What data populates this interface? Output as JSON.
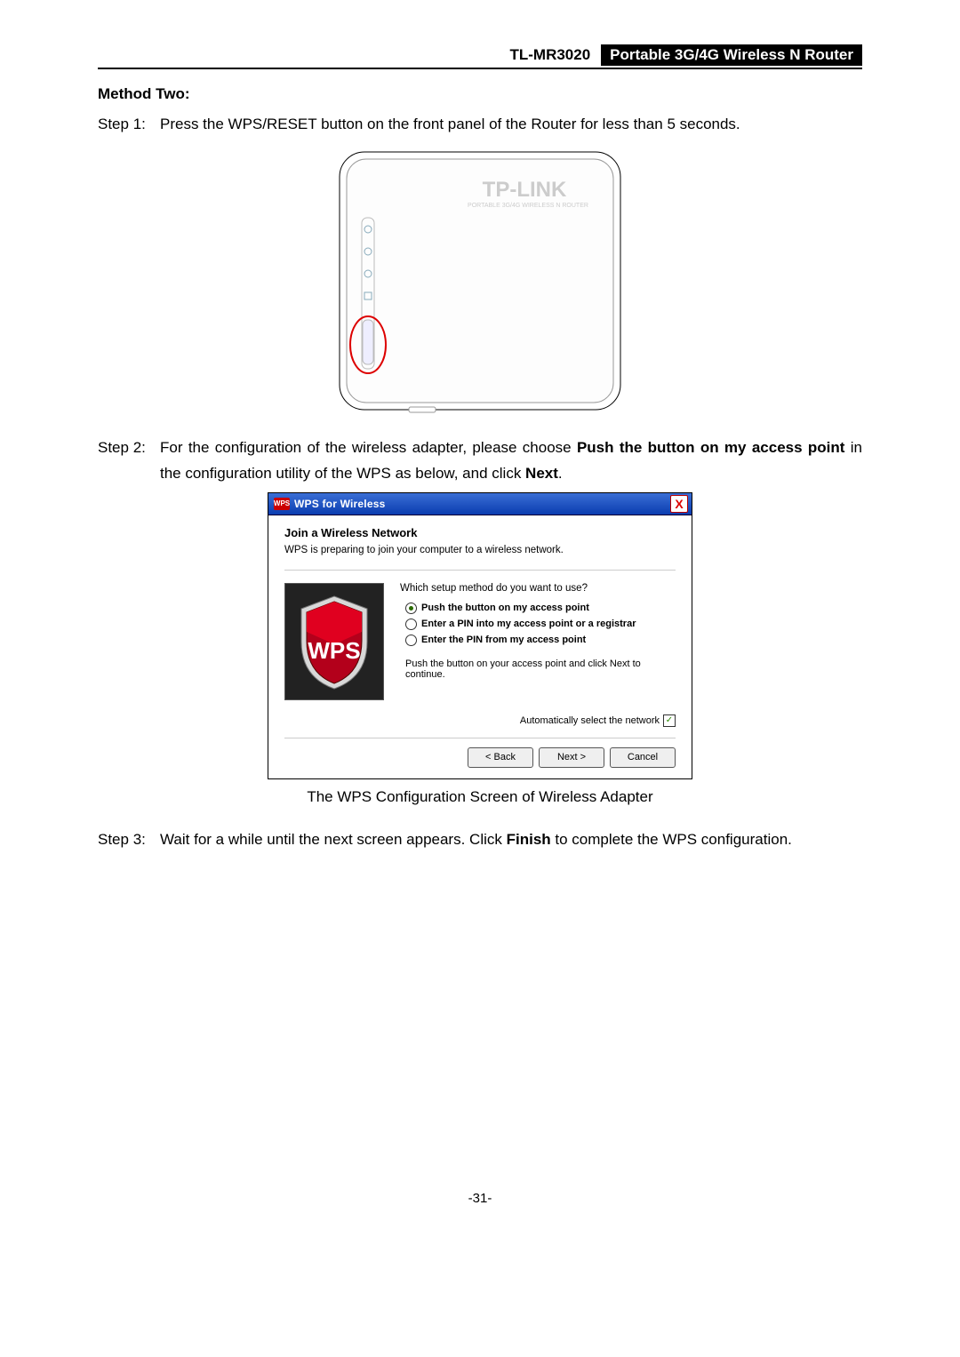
{
  "header": {
    "model": "TL-MR3020",
    "subtitle": "Portable 3G/4G Wireless N Router"
  },
  "method_title": "Method Two:",
  "step1": {
    "label": "Step 1:",
    "text": "Press the WPS/RESET button on the front panel of the Router for less than 5 seconds."
  },
  "router_brand": "TP-LINK",
  "step2": {
    "label": "Step 2:",
    "pre": "For the configuration of the wireless adapter, please choose ",
    "bold1": "Push the button on my access point",
    "mid": " in the configuration utility of the WPS as below, and click ",
    "bold2": "Next",
    "post": "."
  },
  "dialog": {
    "badge": "WPS",
    "title": "WPS for Wireless",
    "close": "X",
    "heading": "Join a Wireless Network",
    "sub": "WPS is preparing to join your computer to a wireless network.",
    "prompt": "Which setup method do you want to use?",
    "opt1": "Push the button on my access point",
    "opt2": "Enter a PIN into my access point or a registrar",
    "opt3": "Enter the PIN from my access point",
    "hint": "Push the button on your access point and click Next to continue.",
    "autosel": "Automatically select the network",
    "shield_text": "WPS",
    "buttons": {
      "back": "< Back",
      "next": "Next >",
      "cancel": "Cancel"
    }
  },
  "caption": "The WPS Configuration Screen of Wireless Adapter",
  "step3": {
    "label": "Step 3:",
    "pre": "Wait for a while until the next screen appears. Click ",
    "bold": "Finish",
    "post": " to complete the WPS configuration."
  },
  "page_number": "-31-"
}
